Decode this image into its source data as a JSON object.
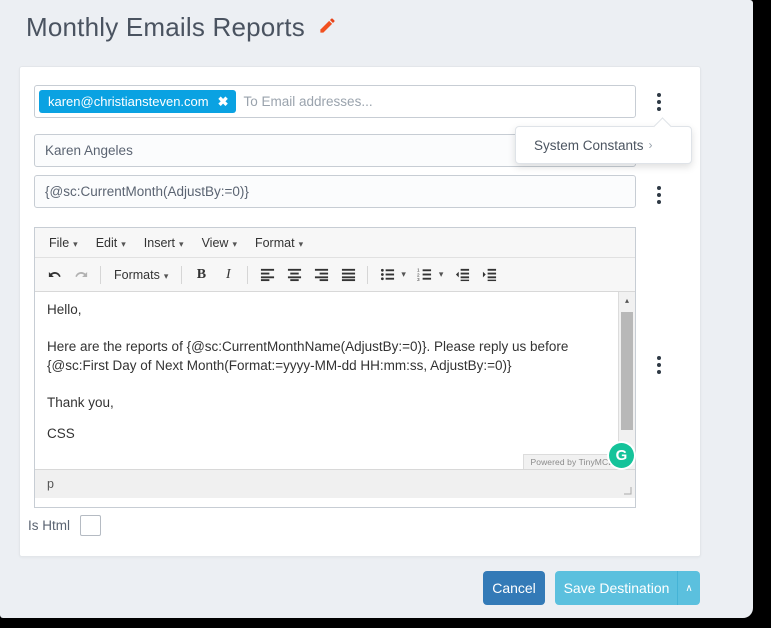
{
  "header": {
    "title": "Monthly Emails Reports",
    "edit_icon": "pencil-icon"
  },
  "form": {
    "to_email": {
      "tag": "karen@christiansteven.com",
      "tag_remove_icon": "✖",
      "placeholder": "To Email addresses..."
    },
    "display_name": {
      "value": "Karen Angeles",
      "placeholder": ""
    },
    "subject": {
      "value": "{@sc:CurrentMonth(AdjustBy:=0)}",
      "placeholder": ""
    },
    "is_html": {
      "label": "Is Html",
      "checked": false
    }
  },
  "popover": {
    "label": "System Constants",
    "caret": "›"
  },
  "editor": {
    "menubar": [
      {
        "label": "File",
        "caret": "▾"
      },
      {
        "label": "Edit",
        "caret": "▾"
      },
      {
        "label": "Insert",
        "caret": "▾"
      },
      {
        "label": "View",
        "caret": "▾"
      },
      {
        "label": "Format",
        "caret": "▾"
      }
    ],
    "toolbar": {
      "undo": "↶",
      "redo": "↷",
      "formats_label": "Formats",
      "formats_caret": "▾",
      "bold": "B",
      "italic": "I",
      "align_left": "align-left-icon",
      "align_center": "align-center-icon",
      "align_right": "align-right-icon",
      "align_justify": "align-justify-icon",
      "bullet_list": "bullet-list-icon",
      "bullet_caret": "▾",
      "numbered_list": "numbered-list-icon",
      "numbered_caret": "▾",
      "outdent": "outdent-icon",
      "indent": "indent-icon"
    },
    "content": {
      "line1": "Hello,",
      "line2": "Here are the reports of {@sc:CurrentMonthName(AdjustBy:=0)}. Please reply us before {@sc:First Day of Next Month(Format:=yyyy-MM-dd HH:mm:ss, AdjustBy:=0)}",
      "line3": "Thank you,",
      "line4": "CSS"
    },
    "branding": "Powered by TinyMCE",
    "statusbar_path": "p",
    "scroll_up": "▴",
    "scroll_down": "▾"
  },
  "overlay": {
    "grammarly_letter": "G"
  },
  "footer": {
    "cancel_label": "Cancel",
    "save_label": "Save Destination",
    "save_caret": "∧"
  },
  "colors": {
    "page_background": "#eceff3",
    "card_background": "#ffffff",
    "email_tag": "#0aa2e2",
    "cancel_button": "#337ab7",
    "save_button": "#5bc0de",
    "pencil_icon": "#f1501f",
    "grammarly_badge": "#15c39a",
    "title_text": "#4a5360"
  }
}
